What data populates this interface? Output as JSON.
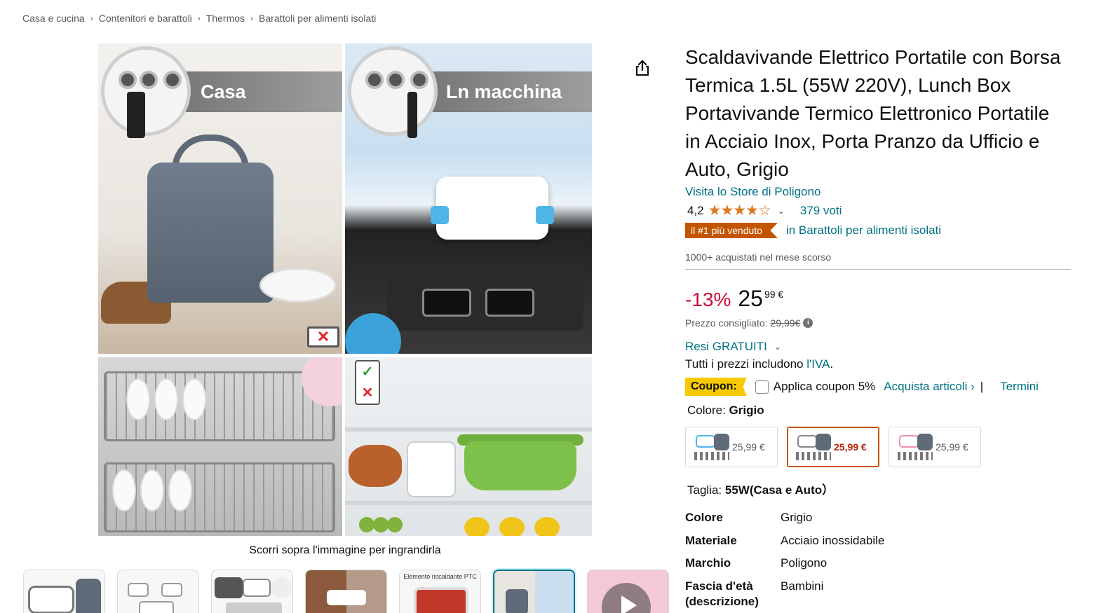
{
  "breadcrumb": [
    "Casa e cucina",
    "Contenitori e barattoli",
    "Thermos",
    "Barattoli per alimenti isolati"
  ],
  "breadcrumb_separator": "›",
  "image": {
    "panel_labels": {
      "home": "Casa",
      "car": "Ln macchina"
    },
    "thumb_caption": "Elemento riscaldante PTC",
    "zoom_hint": "Scorri sopra l'immagine per ingrandirla"
  },
  "product": {
    "title": "Scaldavivande Elettrico Portatile con Borsa Termica 1.5L (55W 220V), Lunch Box Portavivande Termico Elettronico Portatile in Acciaio Inox, Porta Pranzo da Ufficio e Auto, Grigio",
    "store_link": "Visita lo Store di Poligono",
    "rating_value": "4,2",
    "stars": "★★★★☆",
    "rating_count": "379 voti",
    "bestseller_badge": "il #1 più venduto",
    "bestseller_category": "in Barattoli per alimenti isolati",
    "bought_past_month": "1000+ acquistati nel mese scorso"
  },
  "price": {
    "discount": "-13%",
    "whole": "25",
    "fraction": "99 €",
    "list_label": "Prezzo consigliato:",
    "list_value": "29,99€",
    "returns": "Resi GRATUITI",
    "vat_prefix": "Tutti i prezzi includono ",
    "vat_link": "l'IVA",
    "vat_suffix": "."
  },
  "coupon": {
    "badge": "Coupon:",
    "apply_label": "Applica coupon 5%",
    "shop_link": "Acquista articoli ›",
    "separator": "|",
    "terms": "Termini"
  },
  "color": {
    "label": "Colore: ",
    "selected": "Grigio",
    "options": [
      {
        "price": "25,99 €",
        "bag_color": "#5f6b78",
        "accent": "#4fb4e6"
      },
      {
        "price": "25,99 €",
        "bag_color": "#5f6b78",
        "accent": "#888888"
      },
      {
        "price": "25,99 €",
        "bag_color": "#5f6b78",
        "accent": "#f08db0"
      }
    ]
  },
  "size": {
    "label": "Taglia: ",
    "selected": "55W(Casa e Auto）"
  },
  "specs": [
    {
      "key": "Colore",
      "value": "Grigio"
    },
    {
      "key": "Materiale",
      "value": "Acciaio inossidabile"
    },
    {
      "key": "Marchio",
      "value": "Poligono"
    },
    {
      "key": "Fascia d'età (descrizione)",
      "value": "Bambini"
    }
  ],
  "icons": {
    "share": "share-icon",
    "info": "info-icon",
    "chevron": "chevron-down-icon"
  },
  "colors": {
    "link": "#007185",
    "deal_red": "#cc0c39",
    "star": "#de7921",
    "bestseller": "#c45500",
    "coupon": "#f7ca00"
  }
}
